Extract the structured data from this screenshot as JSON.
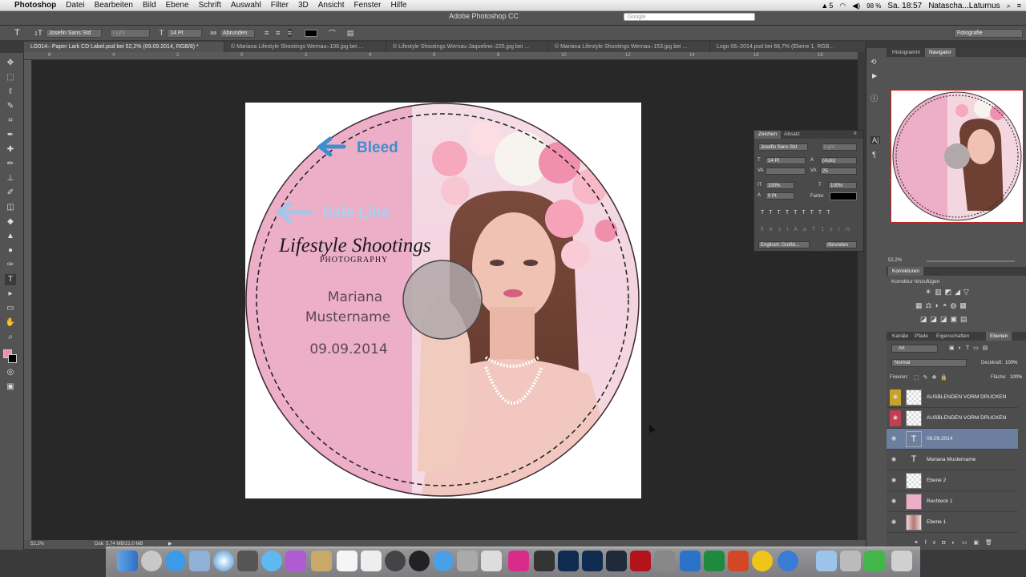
{
  "menubar": {
    "app_name": "Photoshop",
    "items": [
      "Datei",
      "Bearbeiten",
      "Bild",
      "Ebene",
      "Schrift",
      "Auswahl",
      "Filter",
      "3D",
      "Ansicht",
      "Fenster",
      "Hilfe"
    ],
    "window_title": "Adobe Photoshop CC",
    "search_placeholder": "Google",
    "battery": "98 %",
    "clock": "Sa. 18:57",
    "user": "Natascha...Laturnus",
    "notif_count": "5"
  },
  "options_bar": {
    "font_family": "Josefin Sans Std",
    "font_style": "Light",
    "font_size": "14 Pt",
    "antialias": "Abrunden",
    "workspace": "Fotografie"
  },
  "tabs": [
    {
      "label": "LG014– Paper Lark CD Label.psd bei 52,2% (09.09.2014, RGB/8) *",
      "active": true
    },
    {
      "label": "© Mariana Lifestyle Shootings Wernau–106.jpg bei ...",
      "active": false
    },
    {
      "label": "© Lifestyle Shootings Wernau Jaqueline–225.jpg bei ...",
      "active": false
    },
    {
      "label": "© Mariana Lifestyle Shootings Wernau–153.jpg bei ...",
      "active": false
    },
    {
      "label": "Logo 06–2014.psd bei 66,7% (Ebene 1, RGB...",
      "active": false
    }
  ],
  "ruler_ticks": [
    "6",
    "4",
    "2",
    "0",
    "2",
    "4",
    "6",
    "8",
    "10",
    "12",
    "14",
    "16",
    "18"
  ],
  "cd_label": {
    "bleed": "Bleed",
    "safe_line": "Safe Line",
    "brand_script": "Lifestyle Shootings",
    "brand_sub": "PHOTOGRAPHY",
    "name_line1": "Mariana",
    "name_line2": "Mustername",
    "date": "09.09.2014"
  },
  "character_panel": {
    "tab_zeichen": "Zeichen",
    "tab_absatz": "Absatz",
    "font": "Josefin Sans Std",
    "style": "Light",
    "size": "14 Pt",
    "leading": "(Auto)",
    "kerning": "",
    "tracking": "25",
    "vscale": "100%",
    "hscale": "100%",
    "baseline": "0 Pt",
    "color_label": "Farbe:",
    "language": "Englisch: Großb...",
    "antialias": "Abrunden"
  },
  "navigator": {
    "tab_histogram": "Histogramm",
    "tab_navigator": "Navigator",
    "zoom": "52,2%"
  },
  "adjustments": {
    "title": "Korrekturen",
    "subtitle": "Korrektur hinzufügen"
  },
  "layers_panel": {
    "tabs": [
      "Kanäle",
      "Pfade",
      "Eigenschaften",
      "Ebenen"
    ],
    "filter": "Art",
    "blend_mode": "Normal",
    "opacity_label": "Deckkraft:",
    "opacity": "100%",
    "lock_label": "Fixieren:",
    "fill_label": "Fläche:",
    "fill": "100%",
    "layers": [
      {
        "name": "AUSBLENDEN VORM DRUCKEN",
        "type": "pixel",
        "eye_color": "#c9a227"
      },
      {
        "name": "AUSBLENDEN VORM DRUCKEN",
        "type": "pixel",
        "eye_color": "#c0404f"
      },
      {
        "name": "09.09.2014",
        "type": "text",
        "selected": true
      },
      {
        "name": "Mariana  Mustername",
        "type": "text"
      },
      {
        "name": "Ebene 2",
        "type": "pixel"
      },
      {
        "name": "Rechteck 1",
        "type": "shape"
      },
      {
        "name": "Ebene 1",
        "type": "image"
      }
    ]
  },
  "statusbar": {
    "zoom": "52,2%",
    "doc_size": "Dok: 5,74 MB/21,0 MB"
  },
  "colors": {
    "pink": "#edaec7",
    "ui_dark": "#535353",
    "selection": "#6d7f9e",
    "bleed_blue": "#3e8fd1",
    "safe_blue": "#9fc9ec"
  }
}
